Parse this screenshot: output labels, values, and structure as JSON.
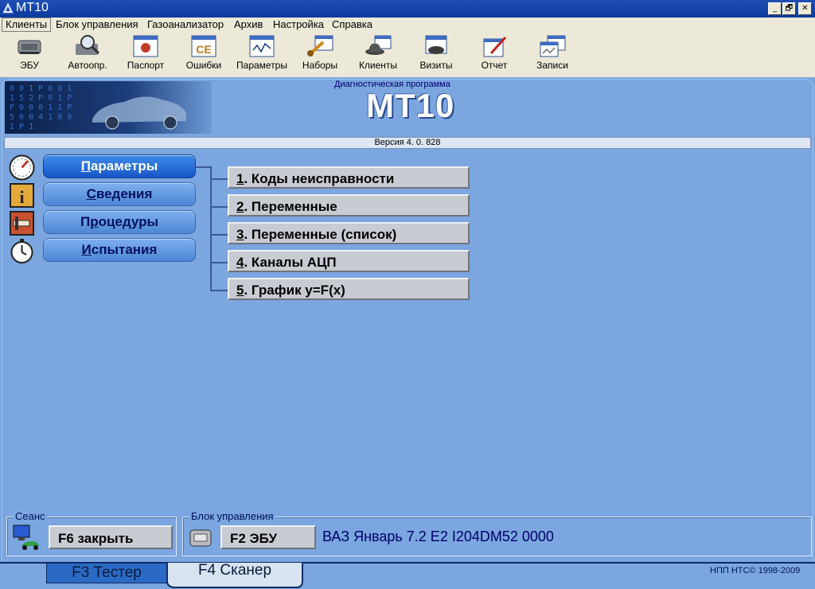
{
  "window": {
    "title": "МТ10",
    "min": "_",
    "max": "🗗",
    "close": "✕"
  },
  "menu": [
    "Клиенты",
    "Блок управления",
    "Газоанализатор",
    "Архив",
    "Настройка",
    "Справка"
  ],
  "toolbar": [
    {
      "label": "ЭБУ",
      "icon": "ecu-icon"
    },
    {
      "label": "Автоопр.",
      "icon": "magnifier-icon"
    },
    {
      "label": "Паспорт",
      "icon": "passport-icon"
    },
    {
      "label": "Ошибки",
      "icon": "errors-icon"
    },
    {
      "label": "Параметры",
      "icon": "parameters-icon"
    },
    {
      "label": "Наборы",
      "icon": "tools-icon"
    },
    {
      "label": "Клиенты",
      "icon": "clients-icon"
    },
    {
      "label": "Визиты",
      "icon": "visits-icon"
    },
    {
      "label": "Отчет",
      "icon": "report-icon"
    },
    {
      "label": "Записи",
      "icon": "records-icon"
    }
  ],
  "banner": {
    "subtitle": "Диагностическая программа",
    "title": "МТ10",
    "version": "Версия  4. 0. 828"
  },
  "ce_text": "CE",
  "side_menu": [
    {
      "label": "Параметры",
      "underline": "П",
      "selected": true
    },
    {
      "label": "Сведения",
      "underline": "С",
      "selected": false
    },
    {
      "label": "Процедуры",
      "underline": "р",
      "selected": false
    },
    {
      "label": "Испытания",
      "underline": "И",
      "selected": false
    }
  ],
  "sub_menu": [
    {
      "num": "1",
      "label": ". Коды неисправности"
    },
    {
      "num": "2",
      "label": ". Переменные"
    },
    {
      "num": "3",
      "label": ". Переменные (список)"
    },
    {
      "num": "4",
      "label": ". Каналы АЦП"
    },
    {
      "num": "5",
      "label": ". График y=F(x)"
    }
  ],
  "session": {
    "group_label": "Сеанс",
    "button": "F6 закрыть"
  },
  "ecu": {
    "group_label": "Блок управления",
    "button": "F2 ЭБУ",
    "info": "ВАЗ Январь 7.2 Е2  I204DM52 0000"
  },
  "tabs": [
    "F3 Тестер",
    "F4 Сканер"
  ],
  "copyright": "НПП НТС© 1998-2009",
  "colors": {
    "background": "#7ba6df",
    "selected_button": "#1856c6",
    "title_bar": "#0a3a9e"
  }
}
